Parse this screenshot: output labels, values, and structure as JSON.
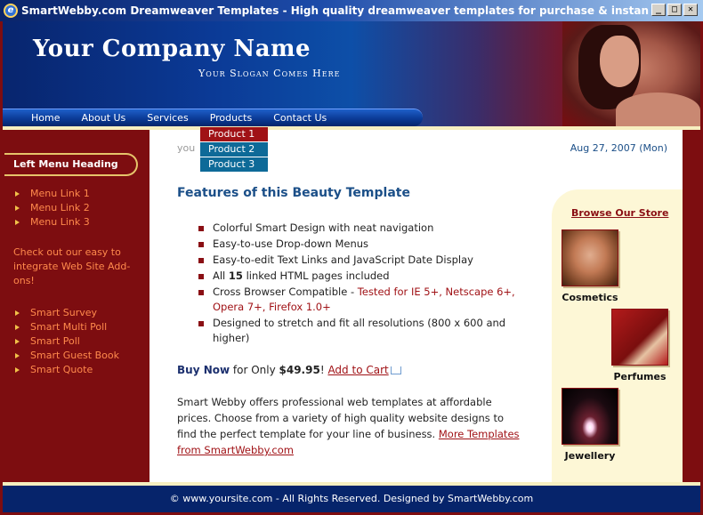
{
  "window": {
    "title": "SmartWebby.com Dreamweaver Templates - High quality dreamweaver templates for purchase & instan - Windows Interne...",
    "minimize": "_",
    "maximize": "□",
    "close": "✕"
  },
  "header": {
    "company_name": "Your Company Name",
    "slogan": "Your Slogan Comes Here",
    "nav": [
      "Home",
      "About Us",
      "Services",
      "Products",
      "Contact Us"
    ],
    "dropdown": [
      "Product 1",
      "Product 2",
      "Product 3"
    ]
  },
  "breadcrumb": "you                me",
  "date": "Aug 27, 2007 (Mon)",
  "left": {
    "heading": "Left Menu Heading",
    "menu_links": [
      "Menu Link 1",
      "Menu Link 2",
      "Menu Link 3"
    ],
    "promo_text": "Check out our easy to integrate Web Site Add-ons!",
    "addons": [
      "Smart Survey",
      "Smart Multi Poll",
      "Smart Poll",
      "Smart Guest Book",
      "Smart Quote"
    ]
  },
  "main": {
    "title": "Features of this Beauty Template",
    "features": {
      "f1": "Colorful Smart Design with neat navigation",
      "f2": "Easy-to-use Drop-down Menus",
      "f3": "Easy-to-edit Text Links and JavaScript Date Display",
      "f4_pre": "All ",
      "f4_bold": "15",
      "f4_post": " linked HTML pages included",
      "f5_pre": "Cross Browser Compatible - ",
      "f5_red": "Tested for IE 5+, Netscape 6+, Opera 7+, Firefox 1.0+",
      "f6": "Designed to stretch and fit all resolutions (800 x 600 and higher)"
    },
    "buy_now": "Buy Now",
    "for_only": " for Only ",
    "price": "$49.95",
    "exclaim": "! ",
    "add_to_cart": "Add to Cart",
    "paragraph": "Smart Webby offers professional web templates at affordable prices. Choose from a variety of high quality website designs to find the perfect template for your line of business. ",
    "more_templates": "More Templates from SmartWebby.com"
  },
  "store": {
    "title": "Browse Our Store",
    "products": [
      "Cosmetics",
      "Perfumes",
      "Jewellery"
    ]
  },
  "footer": "© www.yoursite.com - All Rights Reserved. Designed by SmartWebby.com"
}
